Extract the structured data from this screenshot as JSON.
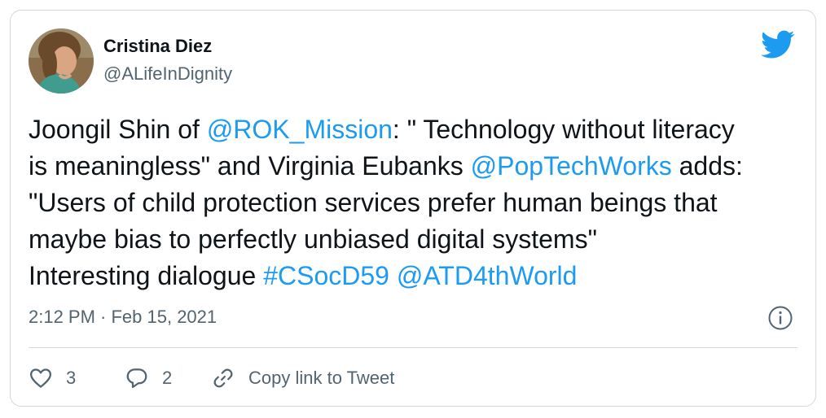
{
  "author": {
    "name": "Cristina Diez",
    "handle": "@ALifeInDignity"
  },
  "tweet": {
    "lines": [
      [
        {
          "text": "Joongil Shin of ",
          "link": false
        },
        {
          "text": "@ROK_Mission",
          "link": true
        },
        {
          "text": ": \" Technology without literacy",
          "link": false
        }
      ],
      [
        {
          "text": "is meaningless\" and Virginia Eubanks ",
          "link": false
        },
        {
          "text": "@PopTechWorks",
          "link": true
        },
        {
          "text": " adds:",
          "link": false
        }
      ],
      [
        {
          "text": "\"Users of child protection services prefer human beings that",
          "link": false
        }
      ],
      [
        {
          "text": "maybe bias to perfectly unbiased digital systems\"",
          "link": false
        }
      ],
      [
        {
          "text": "Interesting dialogue ",
          "link": false
        },
        {
          "text": "#CSocD59",
          "link": true
        },
        {
          "text": " ",
          "link": false
        },
        {
          "text": "@ATD4thWorld",
          "link": true
        }
      ]
    ]
  },
  "meta": {
    "timestamp": "2:12 PM · Feb 15, 2021"
  },
  "actions": {
    "like_count": "3",
    "reply_count": "2",
    "copy_label": "Copy link to Tweet"
  },
  "icons": {
    "brand": "twitter-bird-icon",
    "info": "info-icon",
    "like": "heart-icon",
    "reply": "speech-bubble-icon",
    "copy": "link-chain-icon"
  },
  "colors": {
    "accent": "#1d9bf0",
    "text": "#0f1419",
    "secondary": "#536471",
    "border": "#cfd9de"
  }
}
